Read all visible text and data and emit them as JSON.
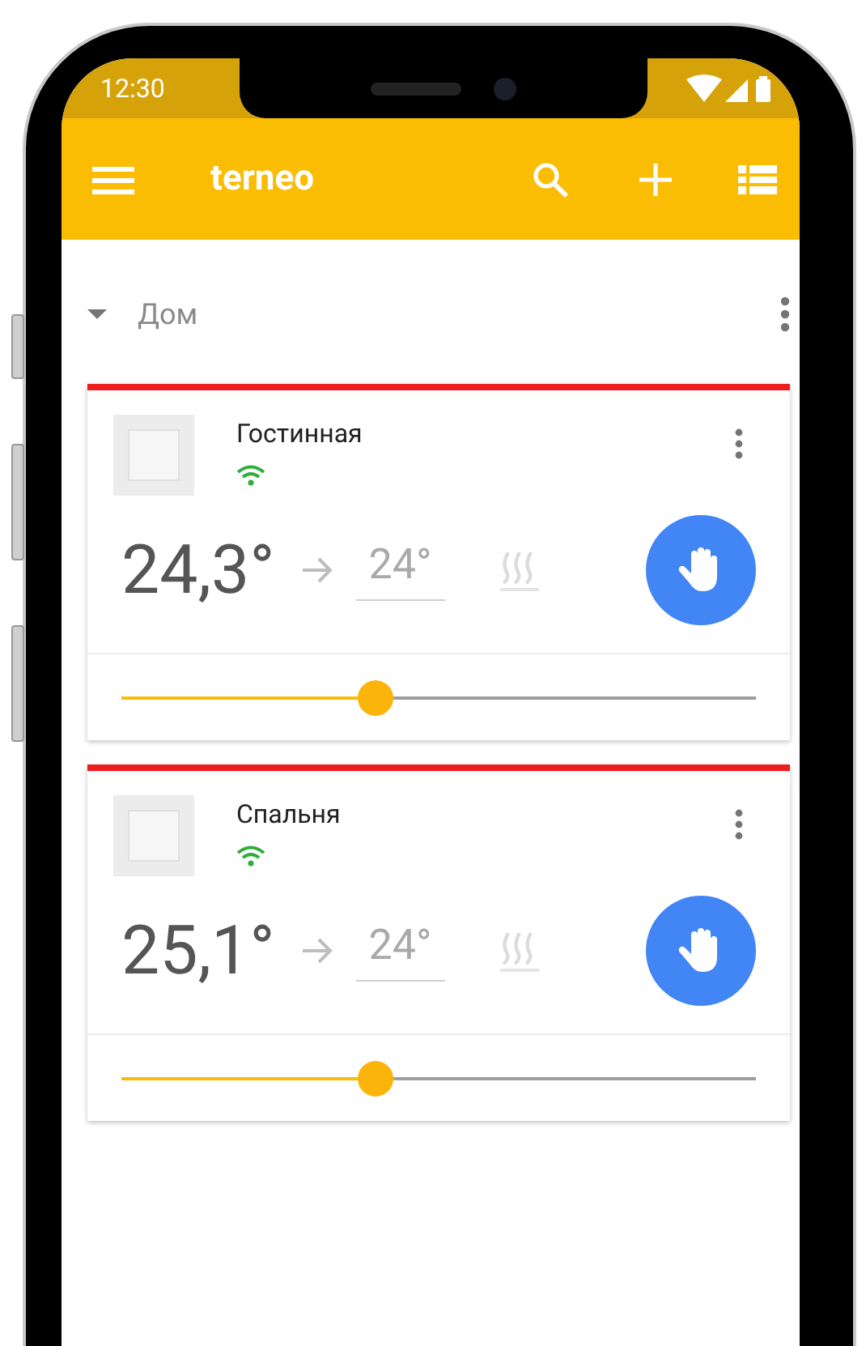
{
  "status_bar": {
    "time": "12:30"
  },
  "app_bar": {
    "title": "terneo"
  },
  "group": {
    "name": "Дом",
    "expanded": true,
    "devices": [
      {
        "name": "Гостинная",
        "current": "24,3°",
        "target": "24°",
        "level": 0.4
      },
      {
        "name": "Спальня",
        "current": "25,1°",
        "target": "24°",
        "level": 0.4
      }
    ]
  }
}
